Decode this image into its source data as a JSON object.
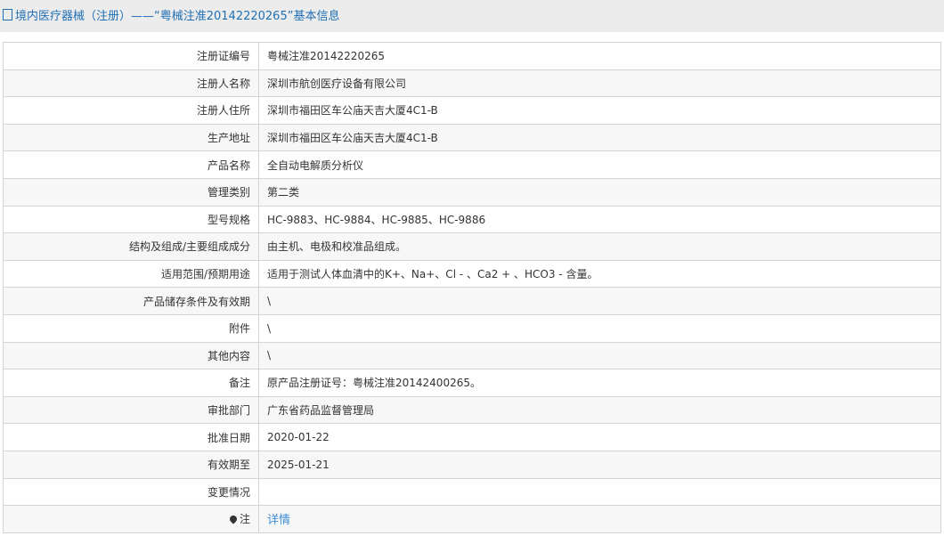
{
  "title": "境内医疗器械（注册）——“粤械注准20142220265”基本信息",
  "rows": [
    {
      "label": "注册证编号",
      "value": "粤械注准20142220265"
    },
    {
      "label": "注册人名称",
      "value": "深圳市航创医疗设备有限公司"
    },
    {
      "label": "注册人住所",
      "value": "深圳市福田区车公庙天吉大厦4C1-B"
    },
    {
      "label": "生产地址",
      "value": "深圳市福田区车公庙天吉大厦4C1-B"
    },
    {
      "label": "产品名称",
      "value": "全自动电解质分析仪"
    },
    {
      "label": "管理类别",
      "value": "第二类"
    },
    {
      "label": "型号规格",
      "value": "HC-9883、HC-9884、HC-9885、HC-9886"
    },
    {
      "label": "结构及组成/主要组成成分",
      "value": "由主机、电极和校准品组成。"
    },
    {
      "label": "适用范围/预期用途",
      "value": "适用于测试人体血清中的K+、Na+、Cl - 、Ca2 + 、HCO3 - 含量。"
    },
    {
      "label": "产品储存条件及有效期",
      "value": "\\"
    },
    {
      "label": "附件",
      "value": "\\"
    },
    {
      "label": "其他内容",
      "value": "\\"
    },
    {
      "label": "备注",
      "value": "原产品注册证号：粤械注准20142400265。"
    },
    {
      "label": "审批部门",
      "value": "广东省药品监督管理局"
    },
    {
      "label": "批准日期",
      "value": "2020-01-22"
    },
    {
      "label": "有效期至",
      "value": "2025-01-21"
    },
    {
      "label": "变更情况",
      "value": ""
    }
  ],
  "note": {
    "label": "注",
    "link": "详情"
  }
}
